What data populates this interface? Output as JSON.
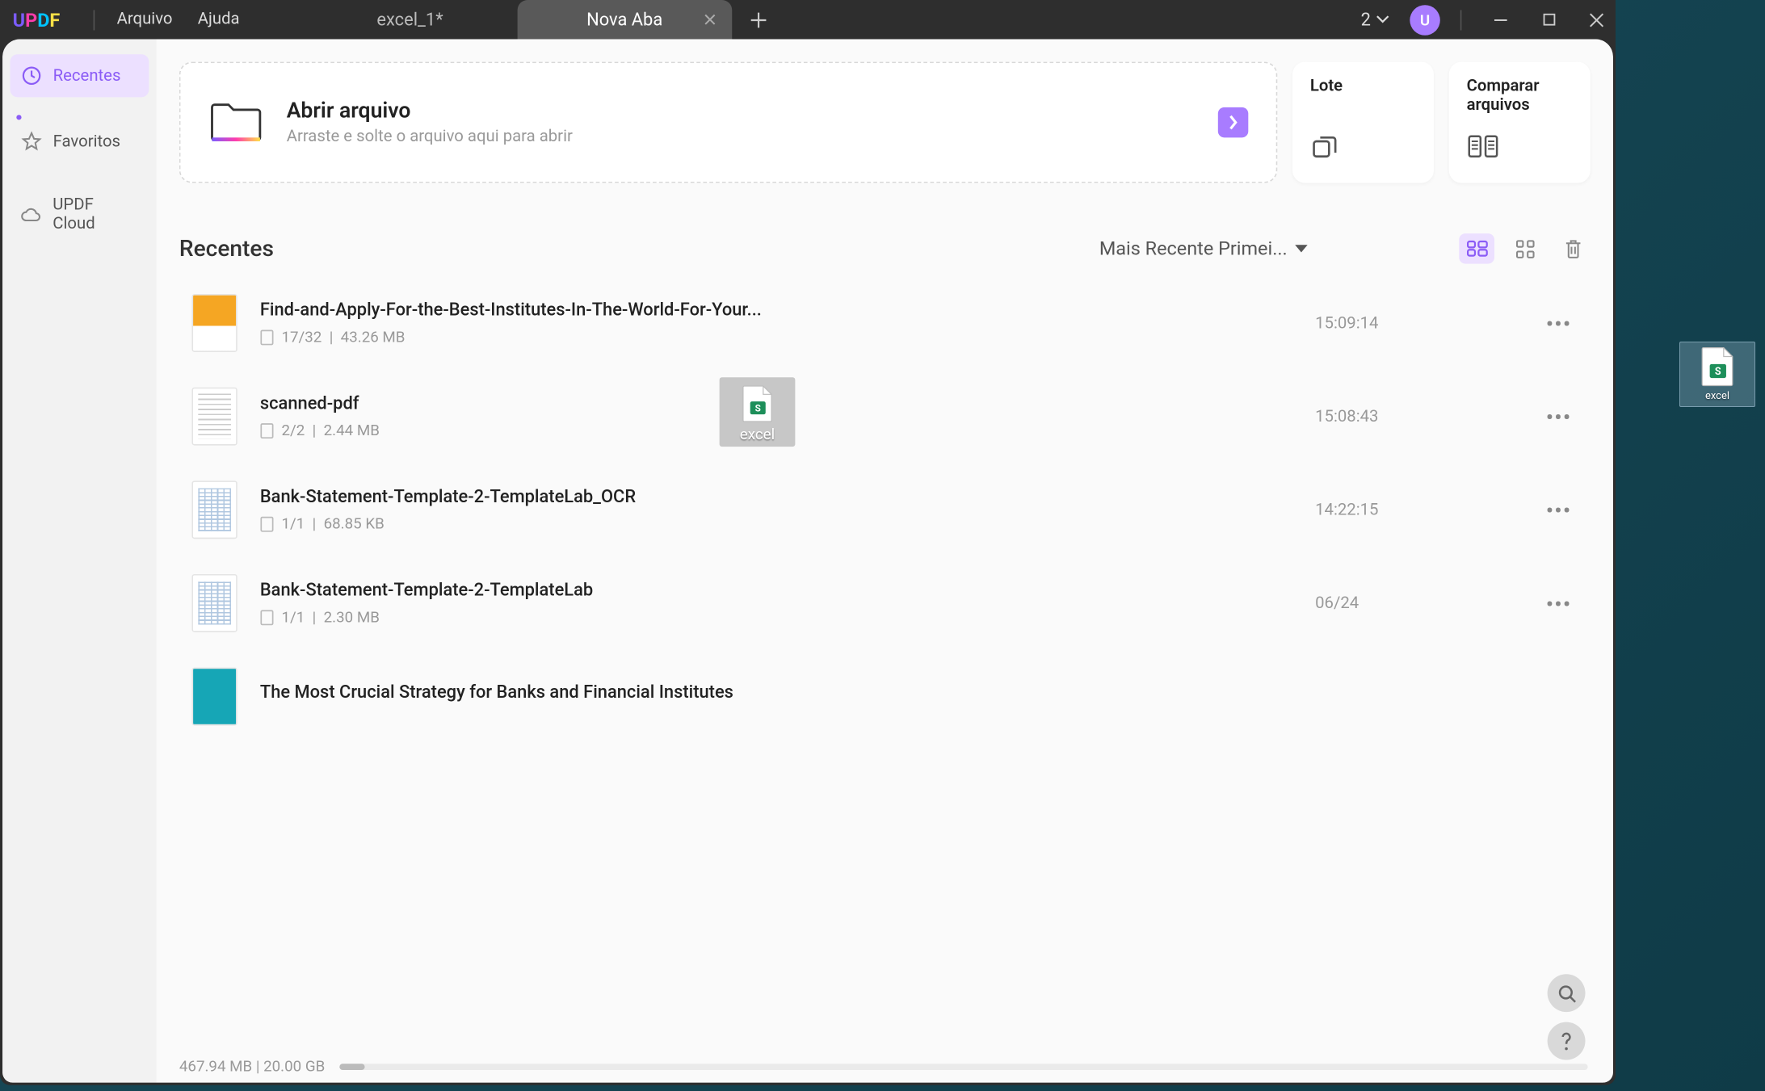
{
  "logo": {
    "u": "U",
    "p": "P",
    "d": "D",
    "f": "F"
  },
  "menu": {
    "arquivo": "Arquivo",
    "ajuda": "Ajuda"
  },
  "tabs": {
    "inactive": "excel_1*",
    "active": "Nova Aba"
  },
  "titlebar": {
    "count": "2",
    "avatar": "U"
  },
  "sidebar": {
    "recentes": "Recentes",
    "favoritos": "Favoritos",
    "cloud": "UPDF Cloud"
  },
  "open_card": {
    "title": "Abrir arquivo",
    "subtitle": "Arraste e solte o arquivo aqui para abrir"
  },
  "small_cards": {
    "lote": "Lote",
    "comparar": "Comparar arquivos"
  },
  "list": {
    "title": "Recentes",
    "sort": "Mais Recente Primei..."
  },
  "files": [
    {
      "name": "Find-and-Apply-For-the-Best-Institutes-In-The-World-For-Your...",
      "pages": "17/32",
      "size": "43.26 MB",
      "date": "15:09:14"
    },
    {
      "name": "scanned-pdf",
      "pages": "2/2",
      "size": "2.44 MB",
      "date": "15:08:43"
    },
    {
      "name": "Bank-Statement-Template-2-TemplateLab_OCR",
      "pages": "1/1",
      "size": "68.85 KB",
      "date": "14:22:15"
    },
    {
      "name": "Bank-Statement-Template-2-TemplateLab",
      "pages": "1/1",
      "size": "2.30 MB",
      "date": "06/24"
    },
    {
      "name": "The Most Crucial Strategy for Banks and Financial Institutes",
      "pages": "",
      "size": "",
      "date": ""
    }
  ],
  "storage": {
    "text": "467.94 MB | 20.00 GB"
  },
  "drag": {
    "label": "excel"
  },
  "desktop": {
    "label": "excel"
  }
}
